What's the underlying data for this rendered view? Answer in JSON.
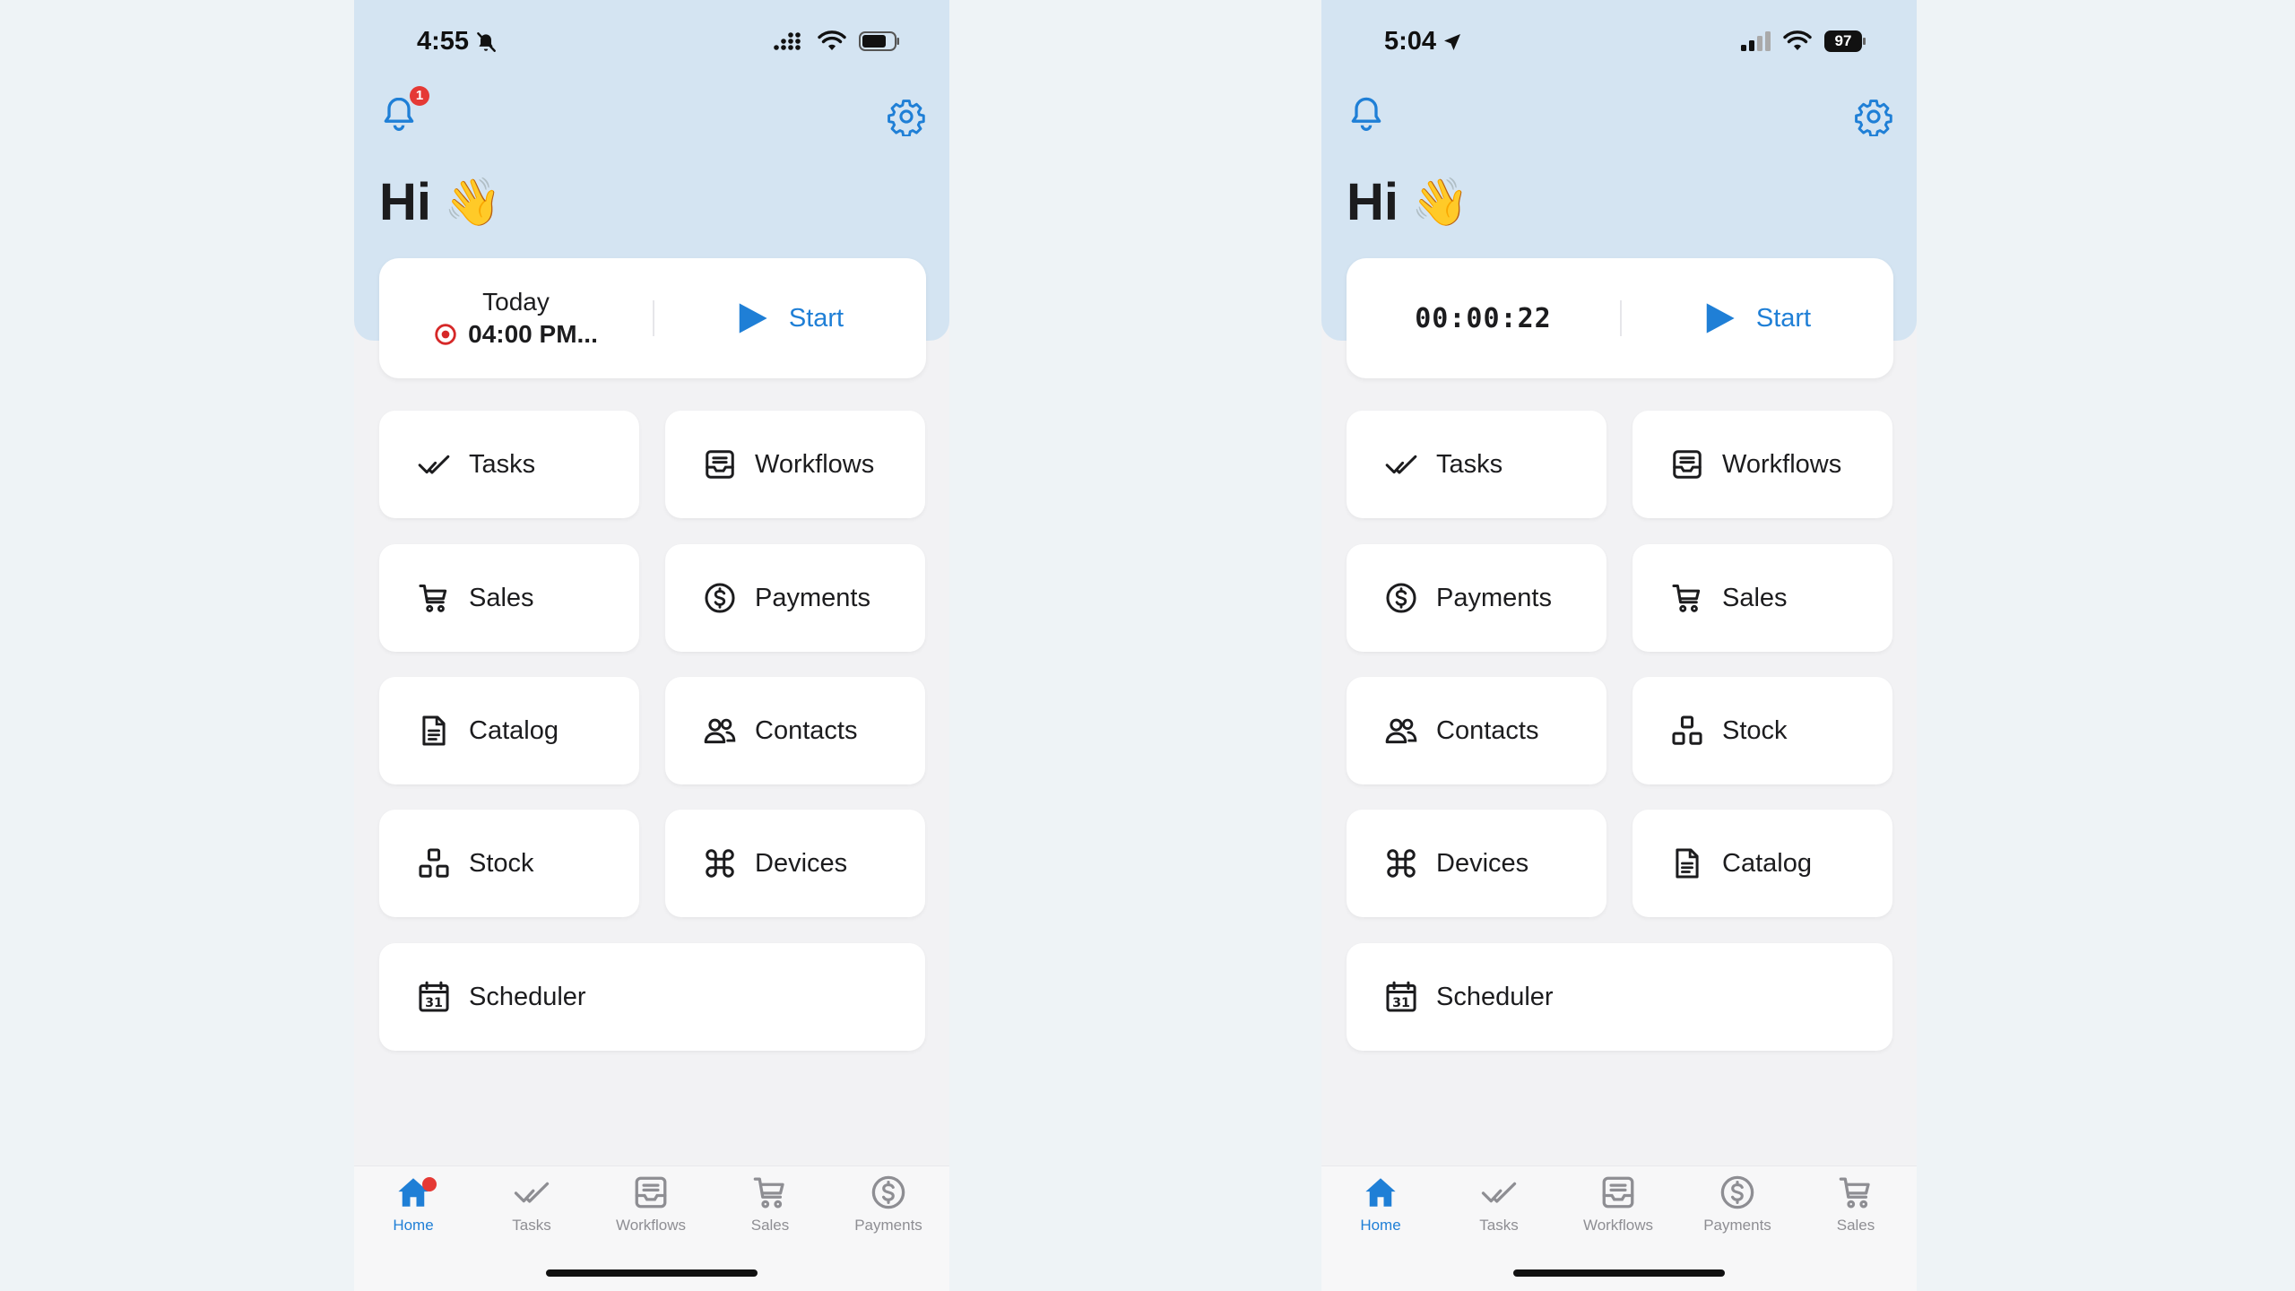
{
  "colors": {
    "accent": "#1f7fd6",
    "hero": "#d4e4f2",
    "badge": "#e53935"
  },
  "left": {
    "status": {
      "time": "4:55"
    },
    "notification_count": "1",
    "greeting": "Hi",
    "greeting_emoji": "👋",
    "timer": {
      "label": "Today",
      "value": "04:00 PM..."
    },
    "start_label": "Start",
    "tiles": [
      {
        "label": "Tasks",
        "icon": "check-icon"
      },
      {
        "label": "Workflows",
        "icon": "inbox-icon"
      },
      {
        "label": "Sales",
        "icon": "cart-icon"
      },
      {
        "label": "Payments",
        "icon": "dollar-icon"
      },
      {
        "label": "Catalog",
        "icon": "document-icon"
      },
      {
        "label": "Contacts",
        "icon": "users-icon"
      },
      {
        "label": "Stock",
        "icon": "stock-icon"
      },
      {
        "label": "Devices",
        "icon": "command-icon"
      },
      {
        "label": "Scheduler",
        "icon": "calendar-icon"
      }
    ],
    "tabs": [
      {
        "label": "Home",
        "icon": "home-icon"
      },
      {
        "label": "Tasks",
        "icon": "check-icon"
      },
      {
        "label": "Workflows",
        "icon": "inbox-icon"
      },
      {
        "label": "Sales",
        "icon": "cart-icon"
      },
      {
        "label": "Payments",
        "icon": "dollar-icon"
      }
    ]
  },
  "right": {
    "status": {
      "time": "5:04",
      "battery": "97"
    },
    "greeting": "Hi",
    "greeting_emoji": "👋",
    "timer": {
      "value": "00:00:22"
    },
    "start_label": "Start",
    "tiles": [
      {
        "label": "Tasks",
        "icon": "check-icon"
      },
      {
        "label": "Workflows",
        "icon": "inbox-icon"
      },
      {
        "label": "Payments",
        "icon": "dollar-icon"
      },
      {
        "label": "Sales",
        "icon": "cart-icon"
      },
      {
        "label": "Contacts",
        "icon": "users-icon"
      },
      {
        "label": "Stock",
        "icon": "stock-icon"
      },
      {
        "label": "Devices",
        "icon": "command-icon"
      },
      {
        "label": "Catalog",
        "icon": "document-icon"
      },
      {
        "label": "Scheduler",
        "icon": "calendar-icon"
      }
    ],
    "tabs": [
      {
        "label": "Home",
        "icon": "home-icon"
      },
      {
        "label": "Tasks",
        "icon": "check-icon"
      },
      {
        "label": "Workflows",
        "icon": "inbox-icon"
      },
      {
        "label": "Payments",
        "icon": "dollar-icon"
      },
      {
        "label": "Sales",
        "icon": "cart-icon"
      }
    ]
  }
}
